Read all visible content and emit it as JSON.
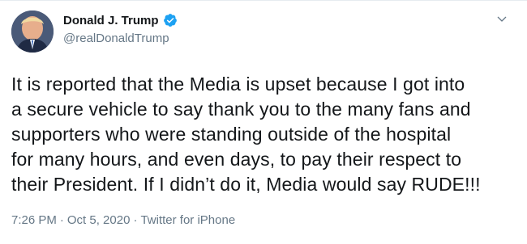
{
  "author": {
    "display_name": "Donald J. Trump",
    "handle": "@realDonaldTrump",
    "verified": true
  },
  "tweet": {
    "text": "It is reported that the Media is upset because I got into\na secure vehicle to say thank you to the many fans and\nsupporters who were standing outside of the hospital\nfor many hours, and even days, to pay their respect to\ntheir President. If I didn’t do it, Media would say RUDE!!!",
    "time": "7:26 PM",
    "separator1": "·",
    "date": "Oct 5, 2020",
    "separator2": "·",
    "source": "Twitter for iPhone"
  },
  "colors": {
    "verified_badge": "#1da1f2",
    "secondary_text": "#657786",
    "primary_text": "#14171a"
  },
  "icons": {
    "verified": "verified-badge-icon",
    "caret": "chevron-down-icon"
  }
}
